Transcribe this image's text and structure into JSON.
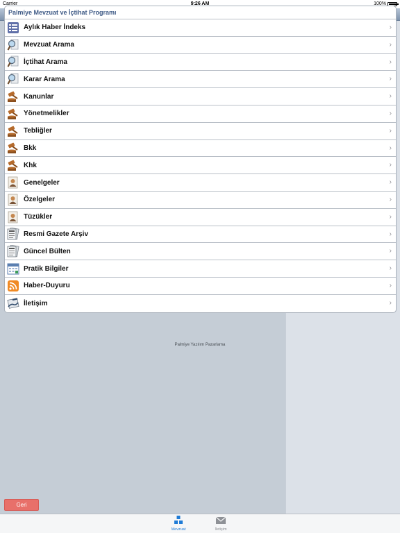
{
  "status_bar": {
    "carrier": "Carrier",
    "time": "9:26 AM",
    "battery": "100%",
    "battery_level": 1.0
  },
  "table": {
    "header": "Palmiye Mevzuat ve İçtihat Programı",
    "rows": [
      {
        "label": "Aylık Haber İndeks",
        "icon": "list-icon"
      },
      {
        "label": "Mevzuat Arama",
        "icon": "search-doc-icon"
      },
      {
        "label": "İçtihat Arama",
        "icon": "search-doc-icon"
      },
      {
        "label": "Karar Arama",
        "icon": "search-doc-icon"
      },
      {
        "label": "Kanunlar",
        "icon": "gavel-icon"
      },
      {
        "label": "Yönetmelikler",
        "icon": "gavel-icon"
      },
      {
        "label": "Tebliğler",
        "icon": "gavel-icon"
      },
      {
        "label": "Bkk",
        "icon": "gavel-icon"
      },
      {
        "label": "Khk",
        "icon": "gavel-icon"
      },
      {
        "label": "Genelgeler",
        "icon": "person-doc-icon"
      },
      {
        "label": "Özelgeler",
        "icon": "person-doc-icon"
      },
      {
        "label": "Tüzükler",
        "icon": "person-doc-icon"
      },
      {
        "label": "Resmi Gazete Arşiv",
        "icon": "newspaper-icon"
      },
      {
        "label": "Güncel Bülten",
        "icon": "newspaper-icon"
      },
      {
        "label": "Pratik Bilgiler",
        "icon": "calendar-icon"
      },
      {
        "label": "Haber-Duyuru",
        "icon": "rss-icon"
      },
      {
        "label": "İletişim",
        "icon": "contact-icon"
      }
    ]
  },
  "footer_note": "Palmiye Yazılım Pazarlama",
  "back_button": "Geri",
  "tabs": [
    {
      "label": "Mevzuat",
      "icon": "grid-icon",
      "active": true
    },
    {
      "label": "İletişim",
      "icon": "mail-icon",
      "active": false
    }
  ],
  "colors": {
    "accent": "#1e7bd6",
    "header_text": "#3e5a86",
    "back_button": "#e8706a"
  }
}
